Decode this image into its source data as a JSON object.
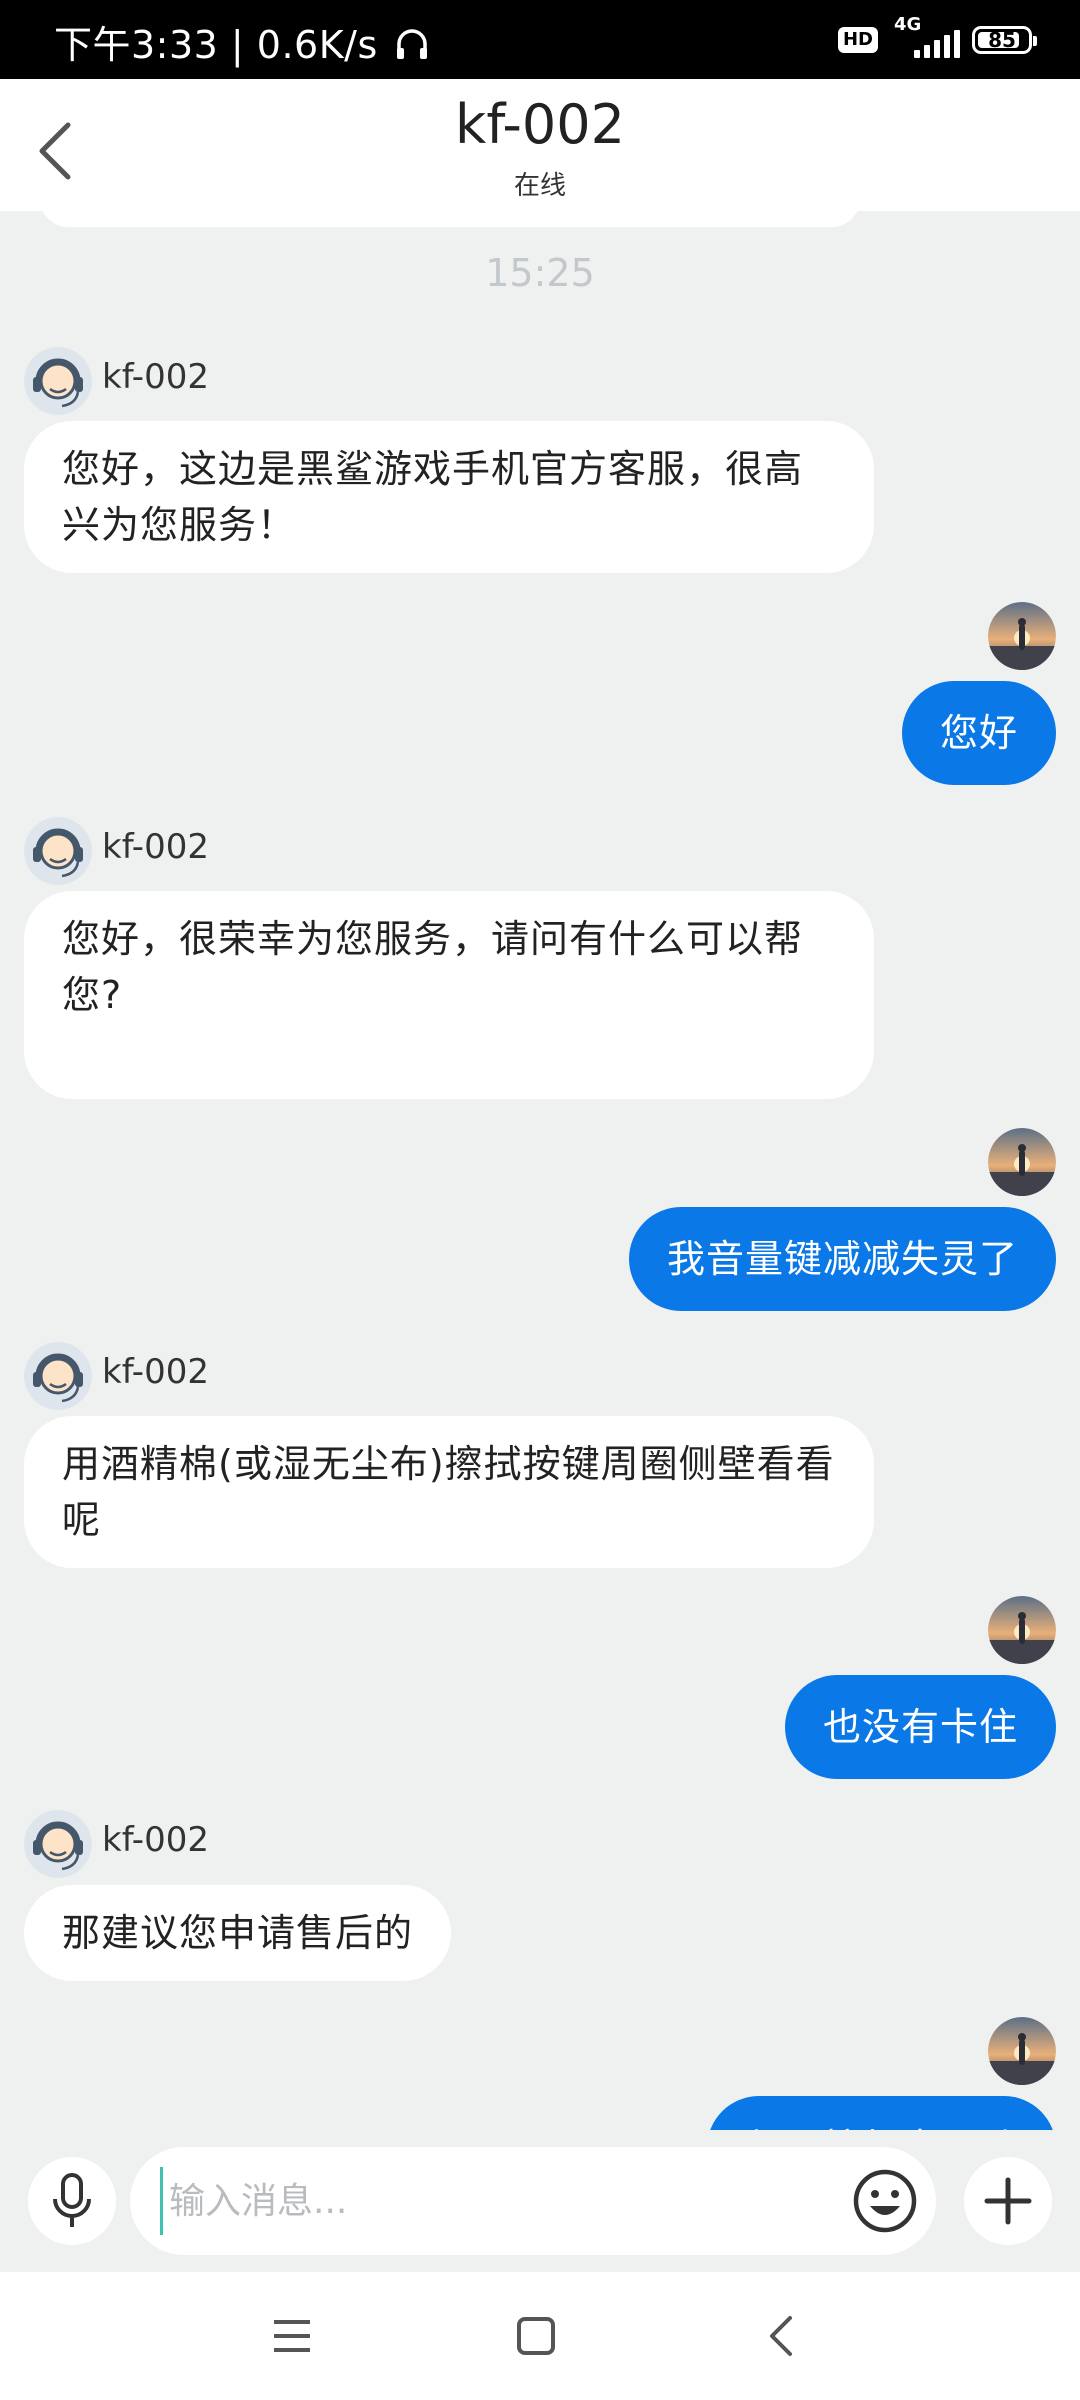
{
  "status_bar": {
    "time_speed": "下午3:33 | 0.6K/s",
    "hd_badge": "HD",
    "network": "4G",
    "battery": "85",
    "battery_level": 0.85
  },
  "header": {
    "title": "kf-002",
    "subtitle": "在线"
  },
  "chat": {
    "timestamp": "15:25",
    "messages": [
      {
        "from": "agent",
        "name": "kf-002",
        "text": "您好，这边是黑鲨游戏手机官方客服，很高兴为您服务！"
      },
      {
        "from": "user",
        "text": "您好"
      },
      {
        "from": "agent",
        "name": "kf-002",
        "text": "您好，很荣幸为您服务，请问有什么可以帮您?"
      },
      {
        "from": "user",
        "text": "我音量键减减失灵了"
      },
      {
        "from": "agent",
        "name": "kf-002",
        "text": "用酒精棉(或湿无尘布)擦拭按键周圈侧壁看看呢"
      },
      {
        "from": "user",
        "text": "也没有卡住"
      },
      {
        "from": "agent",
        "name": "kf-002",
        "text": "那建议您申请售后的"
      },
      {
        "from": "user",
        "text": "但是按起来不动"
      }
    ]
  },
  "input": {
    "placeholder": "输入消息..."
  },
  "icons": {
    "back": "chevron-left-icon",
    "mic": "microphone-icon",
    "emoji": "smiley-icon",
    "add": "plus-icon",
    "nav_menu": "menu-icon",
    "nav_home": "square-icon",
    "nav_back": "triangle-back-icon"
  },
  "colors": {
    "user_bubble": "#0a78e6",
    "agent_bubble": "#ffffff",
    "chat_background": "#eff1f1",
    "timestamp": "#c3c8cc"
  }
}
